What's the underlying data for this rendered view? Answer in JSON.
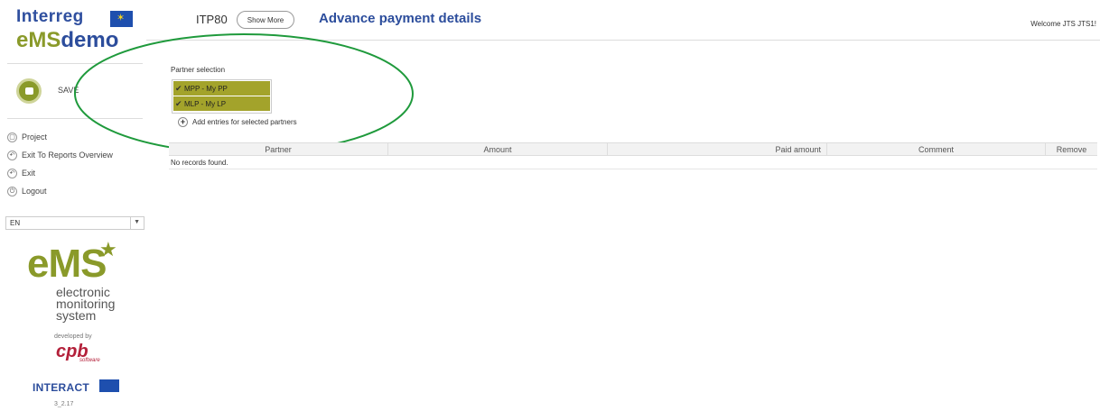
{
  "sidebar": {
    "logo_line1": "Interreg",
    "logo_ems": "eMS",
    "logo_demo": "demo",
    "save_label": "SAVE",
    "nav": [
      {
        "label": "Project",
        "icon": "project-icon",
        "glyph": "▢"
      },
      {
        "label": "Exit To Reports Overview",
        "icon": "back-icon",
        "glyph": "↶"
      },
      {
        "label": "Exit",
        "icon": "exit-icon",
        "glyph": "↶"
      },
      {
        "label": "Logout",
        "icon": "power-icon",
        "glyph": "⏻"
      }
    ],
    "language": "EN",
    "ems_big": "eMS",
    "ems_tag_1": "electronic",
    "ems_tag_2": "monitoring",
    "ems_tag_3": "system",
    "developed_by": "developed by",
    "cpb": "cpb",
    "cpb_software": "software",
    "interact": "INTERACT",
    "version": "3_2.17"
  },
  "header": {
    "project_code": "ITP80",
    "show_more": "Show More",
    "title": "Advance payment details",
    "welcome": "Welcome JTS JTS1!"
  },
  "main": {
    "partner_selection_label": "Partner selection",
    "partners": [
      {
        "label": "MPP - My PP",
        "checked": true
      },
      {
        "label": "MLP - My LP",
        "checked": true
      }
    ],
    "add_entries": "Add entries for selected partners",
    "table": {
      "headers": [
        "Partner",
        "Amount",
        "Paid amount",
        "Comment",
        "Remove"
      ],
      "empty_message": "No records found."
    }
  },
  "colors": {
    "accent_blue": "#2c4d9c",
    "ems_olive": "#8a9a2a",
    "selection_olive": "#a3a32b",
    "annotation_green": "#1f9a3c",
    "cpb_red": "#b3203a"
  }
}
